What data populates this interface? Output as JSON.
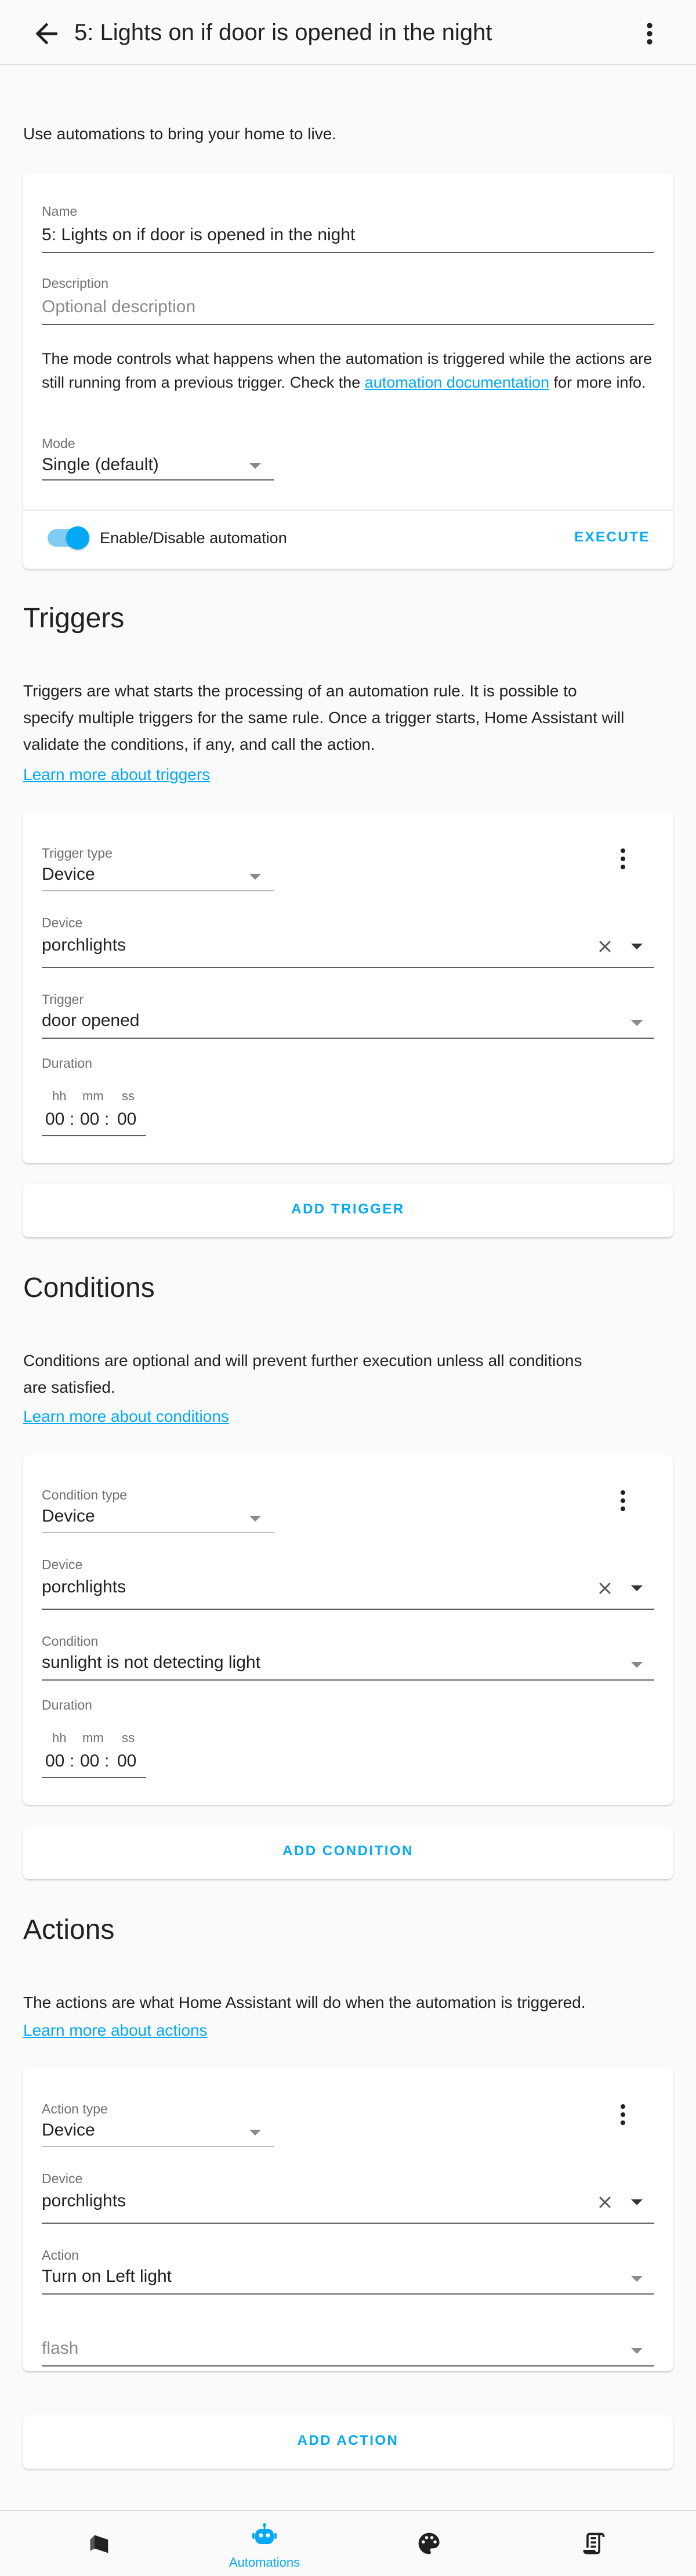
{
  "header": {
    "title": "5: Lights on if door is opened in the night"
  },
  "intro": "Use automations to bring your home to live.",
  "details": {
    "name_label": "Name",
    "name_value": "5: Lights on if door is opened in the night",
    "description_label": "Description",
    "description_placeholder": "Optional description",
    "mode_text_1": "The mode controls what happens when the automation is triggered while the actions are still running from a previous trigger. Check the ",
    "mode_link": "automation documentation",
    "mode_text_2": " for more info.",
    "mode_label": "Mode",
    "mode_value": "Single (default)",
    "toggle_label": "Enable/Disable automation",
    "toggle_on": true,
    "execute_label": "EXECUTE"
  },
  "triggers": {
    "title": "Triggers",
    "description": "Triggers are what starts the processing of an automation rule. It is possible to specify multiple triggers for the same rule. Once a trigger starts, Home Assistant will validate the conditions, if any, and call the action.",
    "learn_more": "Learn more about triggers",
    "type_label": "Trigger type",
    "type_value": "Device",
    "device_label": "Device",
    "device_value": "porchlights",
    "trigger_label": "Trigger",
    "trigger_value": "door opened",
    "duration_label": "Duration",
    "hh": "hh",
    "mm": "mm",
    "ss": "ss",
    "hh_val": "00",
    "mm_val": "00",
    "ss_val": "00",
    "add_label": "ADD TRIGGER"
  },
  "conditions": {
    "title": "Conditions",
    "description": "Conditions are optional and will prevent further execution unless all conditions are satisfied.",
    "learn_more": "Learn more about conditions",
    "type_label": "Condition type",
    "type_value": "Device",
    "device_label": "Device",
    "device_value": "porchlights",
    "condition_label": "Condition",
    "condition_value": "sunlight is not detecting light",
    "duration_label": "Duration",
    "hh": "hh",
    "mm": "mm",
    "ss": "ss",
    "hh_val": "00",
    "mm_val": "00",
    "ss_val": "00",
    "add_label": "ADD CONDITION"
  },
  "actions": {
    "title": "Actions",
    "description": "The actions are what Home Assistant will do when the automation is triggered.",
    "learn_more": "Learn more about actions",
    "type_label": "Action type",
    "type_value": "Device",
    "device_label": "Device",
    "device_value": "porchlights",
    "action_label": "Action",
    "action_value": "Turn on Left light",
    "extra_value": "flash",
    "add_label": "ADD ACTION"
  },
  "bottom_nav": {
    "items": [
      {
        "name": "areas",
        "label": "",
        "icon": "sofa-icon"
      },
      {
        "name": "automations",
        "label": "Automations",
        "icon": "robot-icon"
      },
      {
        "name": "themes",
        "label": "",
        "icon": "palette-icon"
      },
      {
        "name": "scripts",
        "label": "",
        "icon": "script-icon"
      }
    ]
  },
  "colors": {
    "accent": "#03a9f4",
    "text": "#212121",
    "secondary_text": "#6f6f6f",
    "background": "#fafafa"
  }
}
